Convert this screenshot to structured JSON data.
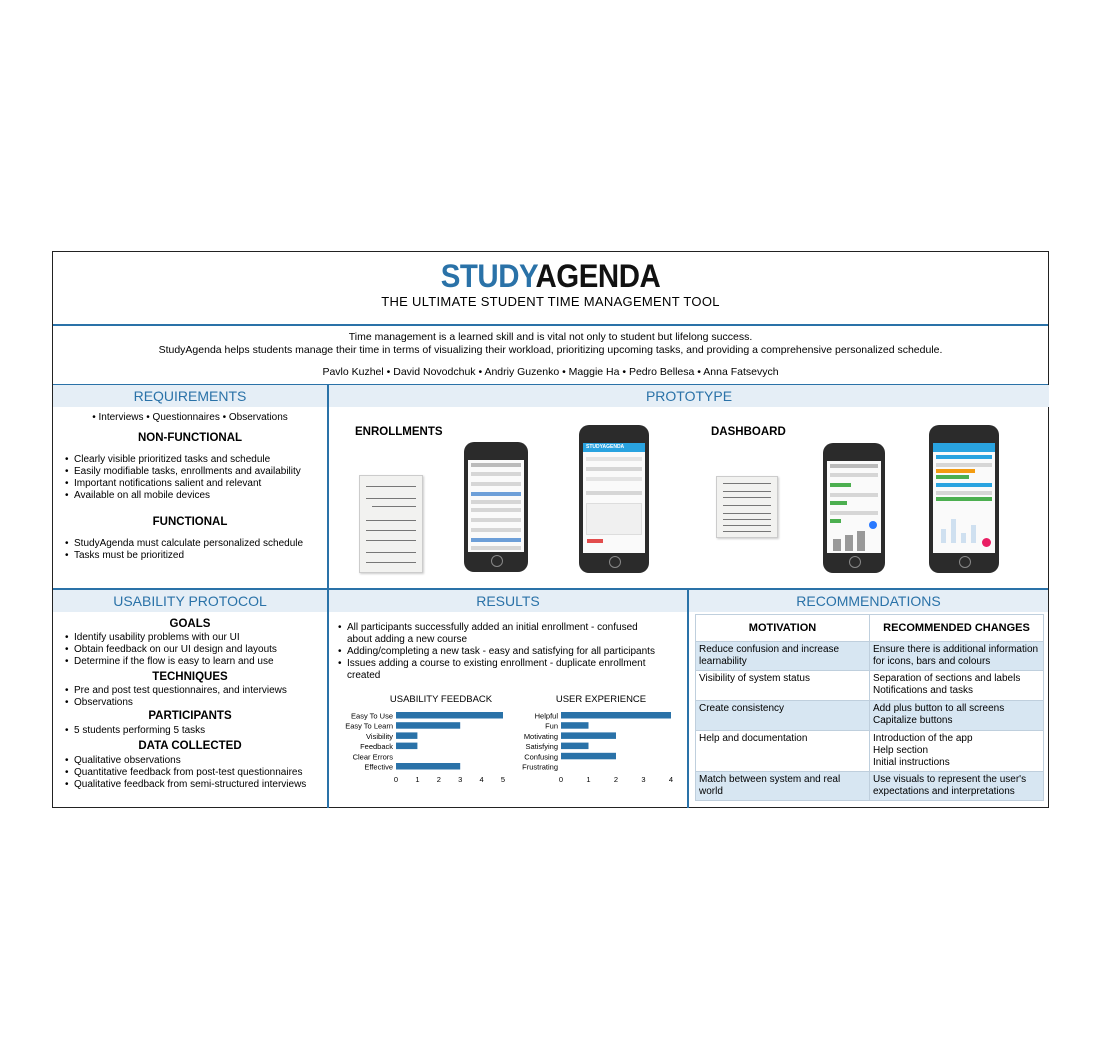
{
  "header": {
    "logo_part1": "STUDY",
    "logo_part2": "AGENDA",
    "subtitle": "THE ULTIMATE STUDENT TIME MANAGEMENT TOOL",
    "intro_line1": "Time management is a learned skill and is vital not only to student but lifelong success.",
    "intro_line2": "StudyAgenda helps students manage their time in terms of visualizing their workload, prioritizing upcoming tasks, and providing a comprehensive personalized schedule.",
    "authors": "Pavlo Kuzhel  •  David  Novodchuk  •  Andriy Guzenko •  Maggie Ha •  Pedro Bellesa •  Anna Fatsevych"
  },
  "requirements": {
    "title": "REQUIREMENTS",
    "methods": "•  Interviews  •  Questionnaires  •  Observations",
    "nonfunctional_heading": "NON-FUNCTIONAL",
    "nonfunctional": [
      "Clearly visible prioritized tasks and schedule",
      "Easily modifiable tasks, enrollments and availability",
      "Important notifications salient and relevant",
      "Available on all mobile devices"
    ],
    "functional_heading": "FUNCTIONAL",
    "functional": [
      "StudyAgenda must calculate personalized schedule",
      "Tasks must be prioritized"
    ]
  },
  "prototype": {
    "title": "PROTOTYPE",
    "enrollments_label": "ENROLLMENTS",
    "dashboard_label": "DASHBOARD",
    "app_logo_study": "STUDY",
    "app_logo_agenda": "AGENDA"
  },
  "usability": {
    "title": "USABILITY PROTOCOL",
    "goals_heading": "GOALS",
    "goals": [
      "Identify usability problems with our UI",
      "Obtain feedback on our UI design and layouts",
      "Determine if the flow is easy to learn and use"
    ],
    "techniques_heading": "TECHNIQUES",
    "techniques": [
      "Pre and post test questionnaires, and interviews",
      "Observations"
    ],
    "participants_heading": "PARTICIPANTS",
    "participants": [
      "5 students performing 5 tasks"
    ],
    "data_heading": "DATA COLLECTED",
    "data": [
      "Qualitative observations",
      "Quantitative feedback from post-test questionnaires",
      "Qualitative feedback from semi-structured interviews"
    ]
  },
  "results": {
    "title": "RESULTS",
    "items": [
      "All participants successfully added an initial enrollment - confused about adding a new course",
      "Adding/completing a new task - easy and satisfying for all participants",
      "Issues adding a course to existing enrollment - duplicate enrollment created"
    ]
  },
  "chart_data": [
    {
      "type": "bar",
      "orientation": "horizontal",
      "title": "USABILITY FEEDBACK",
      "categories": [
        "Easy To Use",
        "Easy To Learn",
        "Visibility",
        "Feedback",
        "Clear Errors",
        "Effective"
      ],
      "values": [
        5,
        3,
        1,
        1,
        0,
        3
      ],
      "xlim": [
        0,
        5
      ],
      "xticks": [
        0,
        1,
        2,
        3,
        4,
        5
      ],
      "color": "#2a72a8"
    },
    {
      "type": "bar",
      "orientation": "horizontal",
      "title": "USER EXPERIENCE",
      "categories": [
        "Helpful",
        "Fun",
        "Motivating",
        "Satisfying",
        "Confusing",
        "Frustrating"
      ],
      "values": [
        4,
        1,
        2,
        1,
        2,
        0
      ],
      "xlim": [
        0,
        4
      ],
      "xticks": [
        0,
        1,
        2,
        3,
        4
      ],
      "color": "#2a72a8"
    }
  ],
  "recommendations": {
    "title": "RECOMMENDATIONS",
    "col1": "MOTIVATION",
    "col2": "RECOMMENDED CHANGES",
    "rows": [
      {
        "motivation": "Reduce confusion and increase learnability",
        "changes": [
          "Ensure there is additional information for icons, bars and colours"
        ]
      },
      {
        "motivation": "Visibility of system status",
        "changes": [
          "Separation of sections and labels",
          "Notifications and tasks"
        ]
      },
      {
        "motivation": "Create consistency",
        "changes": [
          "Add plus button to all screens",
          "Capitalize buttons"
        ]
      },
      {
        "motivation": "Help and documentation",
        "changes": [
          "Introduction of the app",
          "Help section",
          "Initial instructions"
        ]
      },
      {
        "motivation": "Match between system and real world",
        "changes": [
          "Use visuals to represent the user's expectations and interpretations"
        ]
      }
    ]
  }
}
